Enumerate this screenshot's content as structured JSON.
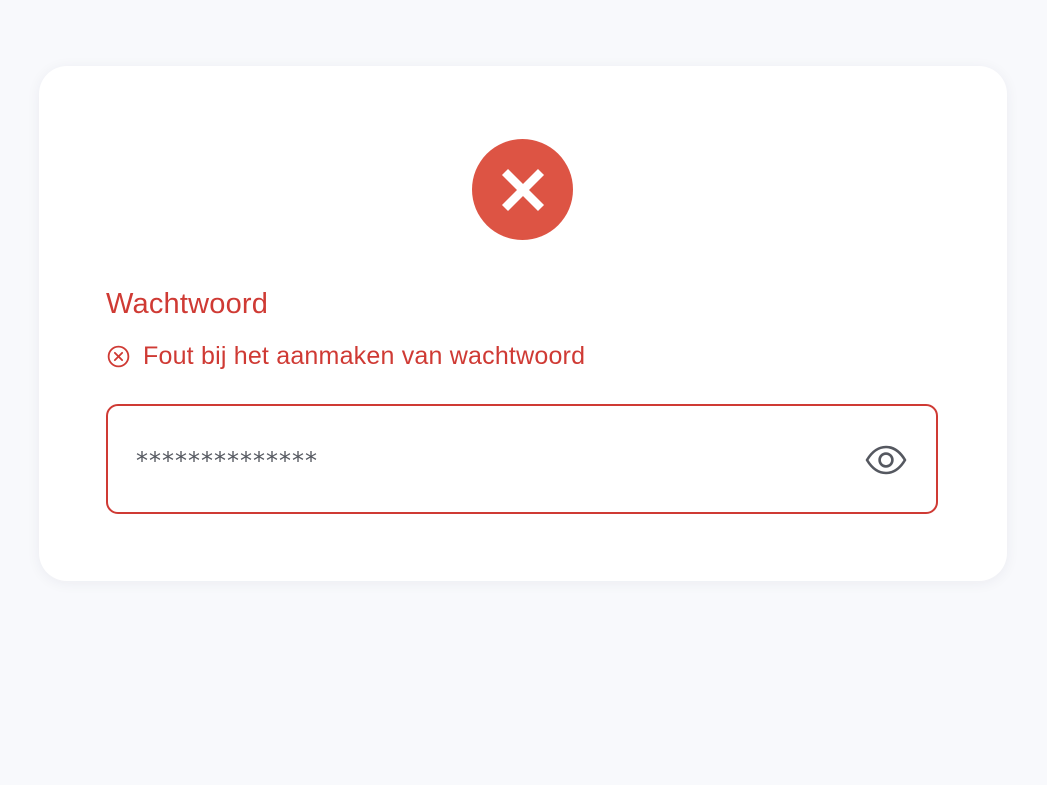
{
  "form": {
    "status_icon": "error-x-icon",
    "label": "Wachtwoord",
    "error": {
      "icon": "circle-x-icon",
      "message": "Fout bij het aanmaken van wachtwoord"
    },
    "password": {
      "value": "**************",
      "toggle_icon": "eye-icon"
    }
  },
  "colors": {
    "error_red": "#cf3a34",
    "badge_red": "#dd5444",
    "background": "#f8f9fc",
    "card": "#ffffff",
    "text_gray": "#555860"
  }
}
